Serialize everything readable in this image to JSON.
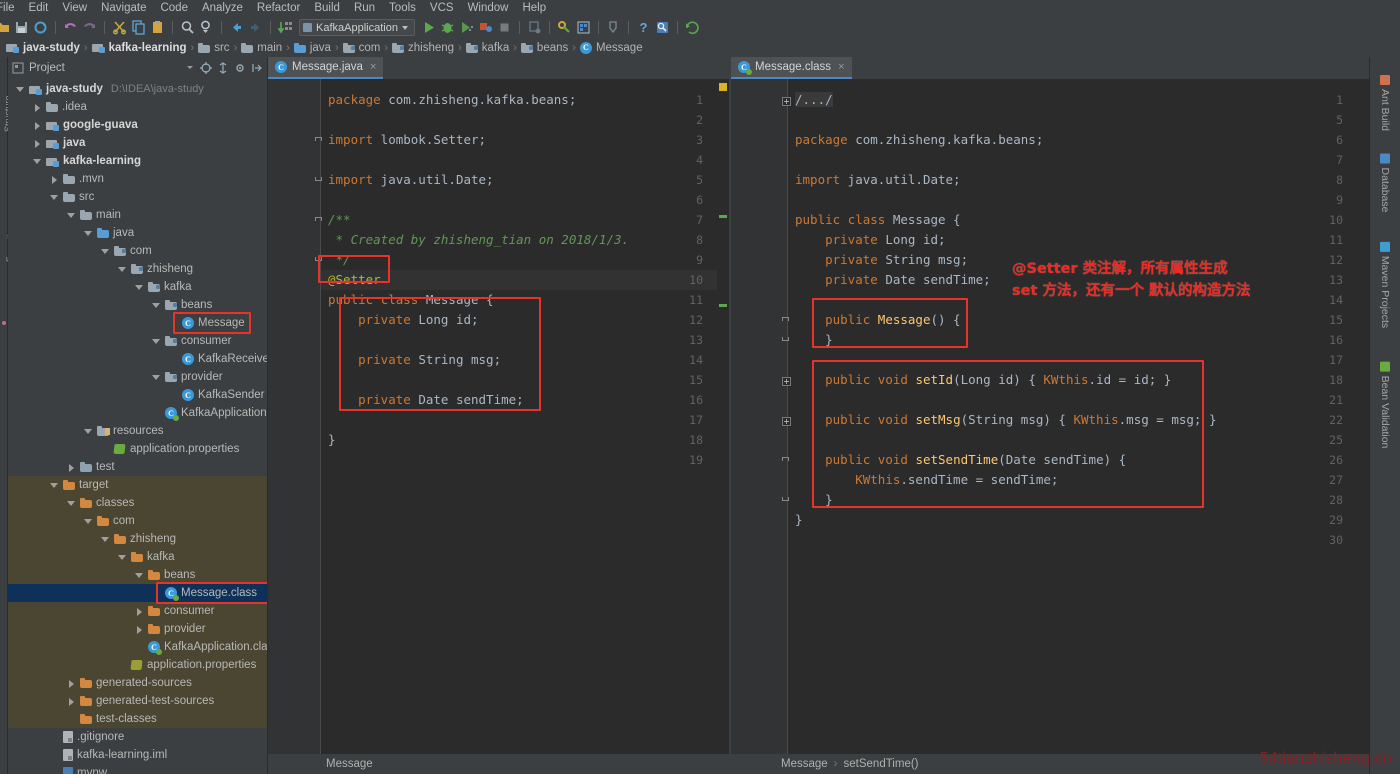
{
  "app": {
    "ide": "IntelliJ IDEA",
    "watermark": "54tianzhisheng.cn"
  },
  "menubar": {
    "items": [
      "File",
      "Edit",
      "View",
      "Navigate",
      "Code",
      "Analyze",
      "Refactor",
      "Build",
      "Run",
      "Tools",
      "VCS",
      "Window",
      "Help"
    ]
  },
  "toolbar": {
    "run_config": "KafkaApplication",
    "icons": [
      "open-folder-icon",
      "save-all-icon",
      "sync-icon",
      "undo-icon",
      "redo-icon",
      "cut-icon",
      "copy-icon",
      "paste-icon",
      "find-icon",
      "replace-icon",
      "back-icon",
      "forward-icon",
      "compile-icon"
    ],
    "run_icons": [
      "run-icon",
      "debug-icon",
      "run-coverage-icon",
      "profile-icon",
      "stop-icon",
      "attach-icon",
      "build-icon",
      "settings-icon",
      "project-structure-icon",
      "sdk-icon",
      "help-icon",
      "search-everywhere-icon",
      "update-project-icon"
    ],
    "help_glyph": "?"
  },
  "breadcrumb": {
    "items": [
      {
        "label": "java-study",
        "icon": "module-icon",
        "bold": true
      },
      {
        "label": "kafka-learning",
        "icon": "module-icon",
        "bold": true
      },
      {
        "label": "src",
        "icon": "folder-icon",
        "bold": false
      },
      {
        "label": "main",
        "icon": "folder-icon",
        "bold": false
      },
      {
        "label": "java",
        "icon": "source-folder-icon",
        "bold": false
      },
      {
        "label": "com",
        "icon": "package-icon",
        "bold": false
      },
      {
        "label": "zhisheng",
        "icon": "package-icon",
        "bold": false
      },
      {
        "label": "kafka",
        "icon": "package-icon",
        "bold": false
      },
      {
        "label": "beans",
        "icon": "package-icon",
        "bold": false
      },
      {
        "label": "Message",
        "icon": "class-icon",
        "bold": false
      }
    ],
    "separator": "›"
  },
  "project_panel": {
    "title": "Project",
    "header_icons": [
      "project-view-icon",
      "collapse-dropdown-icon",
      "locate-icon",
      "expand-all-icon",
      "settings-gear-icon",
      "hide-panel-icon"
    ],
    "tree": [
      {
        "depth": 0,
        "label": "java-study",
        "path": "D:\\IDEA\\java-study",
        "icon": "module-icon",
        "arrow": "down",
        "bold": true
      },
      {
        "depth": 1,
        "label": ".idea",
        "icon": "folder-icon",
        "arrow": "right",
        "bold": false
      },
      {
        "depth": 1,
        "label": "google-guava",
        "icon": "module-icon",
        "arrow": "right",
        "bold": true
      },
      {
        "depth": 1,
        "label": "java",
        "icon": "module-icon",
        "arrow": "right",
        "bold": true
      },
      {
        "depth": 1,
        "label": "kafka-learning",
        "icon": "module-icon",
        "arrow": "down",
        "bold": true
      },
      {
        "depth": 2,
        "label": ".mvn",
        "icon": "folder-icon",
        "arrow": "right",
        "bold": false
      },
      {
        "depth": 2,
        "label": "src",
        "icon": "folder-icon",
        "arrow": "down",
        "bold": false
      },
      {
        "depth": 3,
        "label": "main",
        "icon": "folder-icon",
        "arrow": "down",
        "bold": false
      },
      {
        "depth": 4,
        "label": "java",
        "icon": "source-folder-icon",
        "arrow": "down",
        "bold": false
      },
      {
        "depth": 5,
        "label": "com",
        "icon": "package-icon",
        "arrow": "down",
        "bold": false
      },
      {
        "depth": 6,
        "label": "zhisheng",
        "icon": "package-icon",
        "arrow": "down",
        "bold": false
      },
      {
        "depth": 7,
        "label": "kafka",
        "icon": "package-icon",
        "arrow": "down",
        "bold": false
      },
      {
        "depth": 8,
        "label": "beans",
        "icon": "package-icon",
        "arrow": "down",
        "bold": false
      },
      {
        "depth": 9,
        "label": "Message",
        "icon": "class-icon",
        "arrow": "none",
        "bold": false,
        "highlight": "red-box"
      },
      {
        "depth": 8,
        "label": "consumer",
        "icon": "package-icon",
        "arrow": "down",
        "bold": false
      },
      {
        "depth": 9,
        "label": "KafkaReceiver",
        "icon": "class-icon",
        "arrow": "none",
        "bold": false
      },
      {
        "depth": 8,
        "label": "provider",
        "icon": "package-icon",
        "arrow": "down",
        "bold": false
      },
      {
        "depth": 9,
        "label": "KafkaSender",
        "icon": "class-icon",
        "arrow": "none",
        "bold": false
      },
      {
        "depth": 8,
        "label": "KafkaApplication",
        "icon": "spring-class-icon",
        "arrow": "none",
        "bold": false
      },
      {
        "depth": 4,
        "label": "resources",
        "icon": "resources-folder-icon",
        "arrow": "down",
        "bold": false
      },
      {
        "depth": 5,
        "label": "application.properties",
        "icon": "spring-properties-icon",
        "arrow": "none",
        "bold": false
      },
      {
        "depth": 3,
        "label": "test",
        "icon": "test-folder-icon",
        "arrow": "right",
        "bold": false
      },
      {
        "depth": 2,
        "label": "target",
        "icon": "excluded-folder-icon",
        "arrow": "down",
        "bold": false,
        "scope": "excluded"
      },
      {
        "depth": 3,
        "label": "classes",
        "icon": "excluded-folder-icon",
        "arrow": "down",
        "bold": false,
        "scope": "excluded"
      },
      {
        "depth": 4,
        "label": "com",
        "icon": "excluded-folder-icon",
        "arrow": "down",
        "bold": false,
        "scope": "excluded"
      },
      {
        "depth": 5,
        "label": "zhisheng",
        "icon": "excluded-folder-icon",
        "arrow": "down",
        "bold": false,
        "scope": "excluded"
      },
      {
        "depth": 6,
        "label": "kafka",
        "icon": "excluded-folder-icon",
        "arrow": "down",
        "bold": false,
        "scope": "excluded"
      },
      {
        "depth": 7,
        "label": "beans",
        "icon": "excluded-folder-icon",
        "arrow": "down",
        "bold": false,
        "scope": "excluded"
      },
      {
        "depth": 8,
        "label": "Message.class",
        "icon": "compiled-class-icon",
        "arrow": "none",
        "bold": false,
        "selected": true,
        "highlight": "red-box"
      },
      {
        "depth": 7,
        "label": "consumer",
        "icon": "excluded-folder-icon",
        "arrow": "right",
        "bold": false,
        "scope": "excluded"
      },
      {
        "depth": 7,
        "label": "provider",
        "icon": "excluded-folder-icon",
        "arrow": "right",
        "bold": false,
        "scope": "excluded"
      },
      {
        "depth": 7,
        "label": "KafkaApplication.class",
        "icon": "compiled-class-icon",
        "arrow": "none",
        "bold": false,
        "scope": "excluded"
      },
      {
        "depth": 6,
        "label": "application.properties",
        "icon": "properties-icon",
        "arrow": "none",
        "bold": false,
        "scope": "excluded"
      },
      {
        "depth": 3,
        "label": "generated-sources",
        "icon": "excluded-folder-icon",
        "arrow": "right",
        "bold": false,
        "scope": "excluded"
      },
      {
        "depth": 3,
        "label": "generated-test-sources",
        "icon": "excluded-folder-icon",
        "arrow": "right",
        "bold": false,
        "scope": "excluded"
      },
      {
        "depth": 3,
        "label": "test-classes",
        "icon": "excluded-folder-icon",
        "arrow": "none",
        "bold": false,
        "scope": "excluded"
      },
      {
        "depth": 2,
        "label": ".gitignore",
        "icon": "file-icon",
        "arrow": "none",
        "bold": false
      },
      {
        "depth": 2,
        "label": "kafka-learning.iml",
        "icon": "iml-file-icon",
        "arrow": "none",
        "bold": false
      },
      {
        "depth": 2,
        "label": "mvnw",
        "icon": "script-file-icon",
        "arrow": "none",
        "bold": false
      }
    ]
  },
  "editor_left": {
    "tab": {
      "label": "Message.java",
      "icon": "java-class-icon",
      "close": "×",
      "active": true
    },
    "breadcrumb": [
      "Message"
    ],
    "line_numbers": [
      1,
      2,
      3,
      4,
      5,
      6,
      7,
      8,
      9,
      10,
      11,
      12,
      13,
      14,
      15,
      16,
      17,
      18,
      19
    ],
    "lines": [
      {
        "n": 1,
        "text": "package com.zhisheng.kafka.beans;"
      },
      {
        "n": 2,
        "text": ""
      },
      {
        "n": 3,
        "text": "import lombok.Setter;"
      },
      {
        "n": 4,
        "text": ""
      },
      {
        "n": 5,
        "text": "import java.util.Date;"
      },
      {
        "n": 6,
        "text": ""
      },
      {
        "n": 7,
        "text": "/**"
      },
      {
        "n": 8,
        "text": " * Created by zhisheng_tian on 2018/1/3."
      },
      {
        "n": 9,
        "text": " */"
      },
      {
        "n": 10,
        "text": "@Setter"
      },
      {
        "n": 11,
        "text": "public class Message {"
      },
      {
        "n": 12,
        "text": "    private Long id;"
      },
      {
        "n": 13,
        "text": ""
      },
      {
        "n": 14,
        "text": "    private String msg;"
      },
      {
        "n": 15,
        "text": ""
      },
      {
        "n": 16,
        "text": "    private Date sendTime;"
      },
      {
        "n": 17,
        "text": ""
      },
      {
        "n": 18,
        "text": "}"
      },
      {
        "n": 19,
        "text": ""
      }
    ]
  },
  "editor_right": {
    "tab": {
      "label": "Message.class",
      "icon": "compiled-class-icon",
      "close": "×",
      "active": false
    },
    "breadcrumb": [
      "Message",
      "setSendTime()"
    ],
    "line_numbers": [
      1,
      5,
      6,
      7,
      8,
      9,
      10,
      11,
      12,
      13,
      14,
      15,
      16,
      17,
      18,
      21,
      22,
      25,
      26,
      27,
      28,
      29,
      30
    ],
    "lines": [
      {
        "n": 1,
        "text": "/.../"
      },
      {
        "n": 5,
        "text": ""
      },
      {
        "n": 6,
        "text": "package com.zhisheng.kafka.beans;"
      },
      {
        "n": 7,
        "text": ""
      },
      {
        "n": 8,
        "text": "import java.util.Date;"
      },
      {
        "n": 9,
        "text": ""
      },
      {
        "n": 10,
        "text": "public class Message {"
      },
      {
        "n": 11,
        "text": "    private Long id;"
      },
      {
        "n": 12,
        "text": "    private String msg;"
      },
      {
        "n": 13,
        "text": "    private Date sendTime;"
      },
      {
        "n": 14,
        "text": ""
      },
      {
        "n": 15,
        "text": "    public Message() {"
      },
      {
        "n": 16,
        "text": "    }"
      },
      {
        "n": 17,
        "text": ""
      },
      {
        "n": 18,
        "text": "    public void setId(Long id) { this.id = id; }"
      },
      {
        "n": 21,
        "text": ""
      },
      {
        "n": 22,
        "text": "    public void setMsg(String msg) { this.msg = msg; }"
      },
      {
        "n": 25,
        "text": ""
      },
      {
        "n": 26,
        "text": "    public void setSendTime(Date sendTime) {"
      },
      {
        "n": 27,
        "text": "        this.sendTime = sendTime;"
      },
      {
        "n": 28,
        "text": "    }"
      },
      {
        "n": 29,
        "text": "}"
      },
      {
        "n": 30,
        "text": ""
      }
    ]
  },
  "annotation": {
    "line1": "@Setter 类注解，所有属性生成",
    "line2": "set 方法，还有一个 默认的构造方法",
    "color": "#ee2a22"
  },
  "right_sidebar": {
    "items": [
      {
        "label": "Ant Build",
        "icon": "ant-build-icon",
        "color": "#d0724b"
      },
      {
        "label": "Database",
        "icon": "database-icon",
        "color": "#4a88c7"
      },
      {
        "label": "Maven Projects",
        "icon": "maven-icon",
        "color": "#3f9ed0"
      },
      {
        "label": "Bean Validation",
        "icon": "bean-validation-icon",
        "color": "#6aab3f"
      }
    ]
  },
  "left_sidebar": {
    "items": [
      {
        "label": "Structure",
        "icon": "structure-icon"
      },
      {
        "label": "Favorites",
        "icon": "favorites-icon"
      }
    ]
  },
  "colors": {
    "bg_ui": "#3c3f41",
    "bg_editor": "#2b2b2b",
    "gutter": "#313335",
    "accent_blue": "#4a88c7",
    "selection": "#0d3158",
    "excluded_scope": "#4a4632",
    "annotation_red": "#ee2a22",
    "keyword": "#cc7832",
    "comment": "#629755",
    "annotation_token": "#bbb529",
    "text": "#a9b7c6"
  }
}
